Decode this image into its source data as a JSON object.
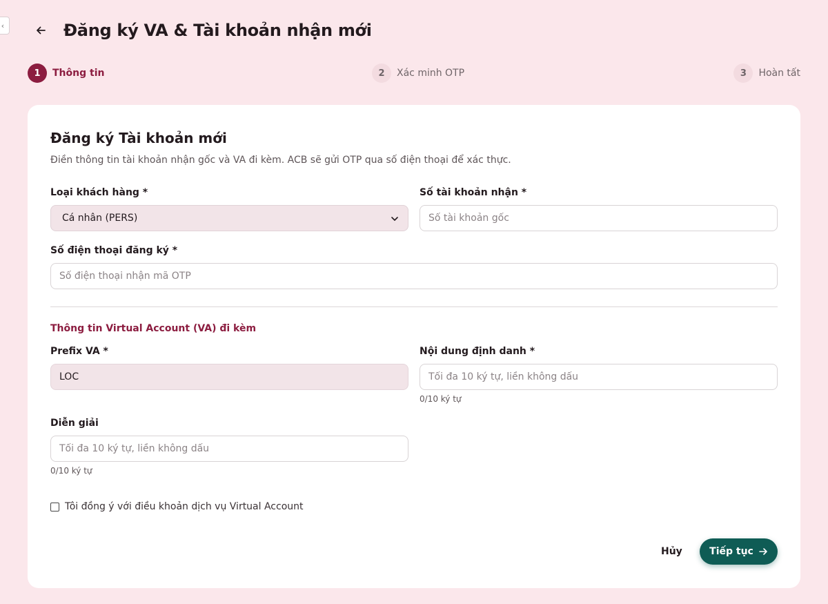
{
  "header": {
    "title": "Đăng ký VA & Tài khoản nhận mới"
  },
  "stepper": [
    {
      "num": "1",
      "label": "Thông tin",
      "active": true
    },
    {
      "num": "2",
      "label": "Xác minh OTP",
      "active": false
    },
    {
      "num": "3",
      "label": "Hoàn tất",
      "active": false
    }
  ],
  "form": {
    "title": "Đăng ký Tài khoản mới",
    "description": "Điền thông tin tài khoản nhận gốc và VA đi kèm. ACB sẽ gửi OTP qua số điện thoại để xác thực.",
    "customer_type": {
      "label": "Loại khách hàng *",
      "value": "Cá nhân (PERS)"
    },
    "account_number": {
      "label": "Số tài khoản nhận *",
      "placeholder": "Số tài khoản gốc",
      "value": ""
    },
    "phone": {
      "label": "Số điện thoại đăng ký *",
      "placeholder": "Số điện thoại nhận mã OTP",
      "value": ""
    },
    "va_section_title": "Thông tin Virtual Account (VA) đi kèm",
    "prefix": {
      "label": "Prefix VA *",
      "value": "LOC"
    },
    "identifier": {
      "label": "Nội dung định danh *",
      "placeholder": "Tối đa 10 ký tự, liền không dấu",
      "counter": "0/10 ký tự"
    },
    "description_field": {
      "label": "Diễn giải",
      "placeholder": "Tối đa 10 ký tự, liền không dấu",
      "counter": "0/10 ký tự"
    },
    "terms_label": "Tôi đồng ý với điều khoản dịch vụ Virtual Account",
    "terms_checked": false
  },
  "actions": {
    "cancel_label": "Hủy",
    "next_label": "Tiếp tục"
  },
  "icons": {
    "back": "arrow-left-icon",
    "select": "chevron-down-icon",
    "next": "arrow-right-icon"
  },
  "colors": {
    "brand": "#8c1d40",
    "primary_button": "#0f5c55",
    "background": "#fbe7eb"
  }
}
